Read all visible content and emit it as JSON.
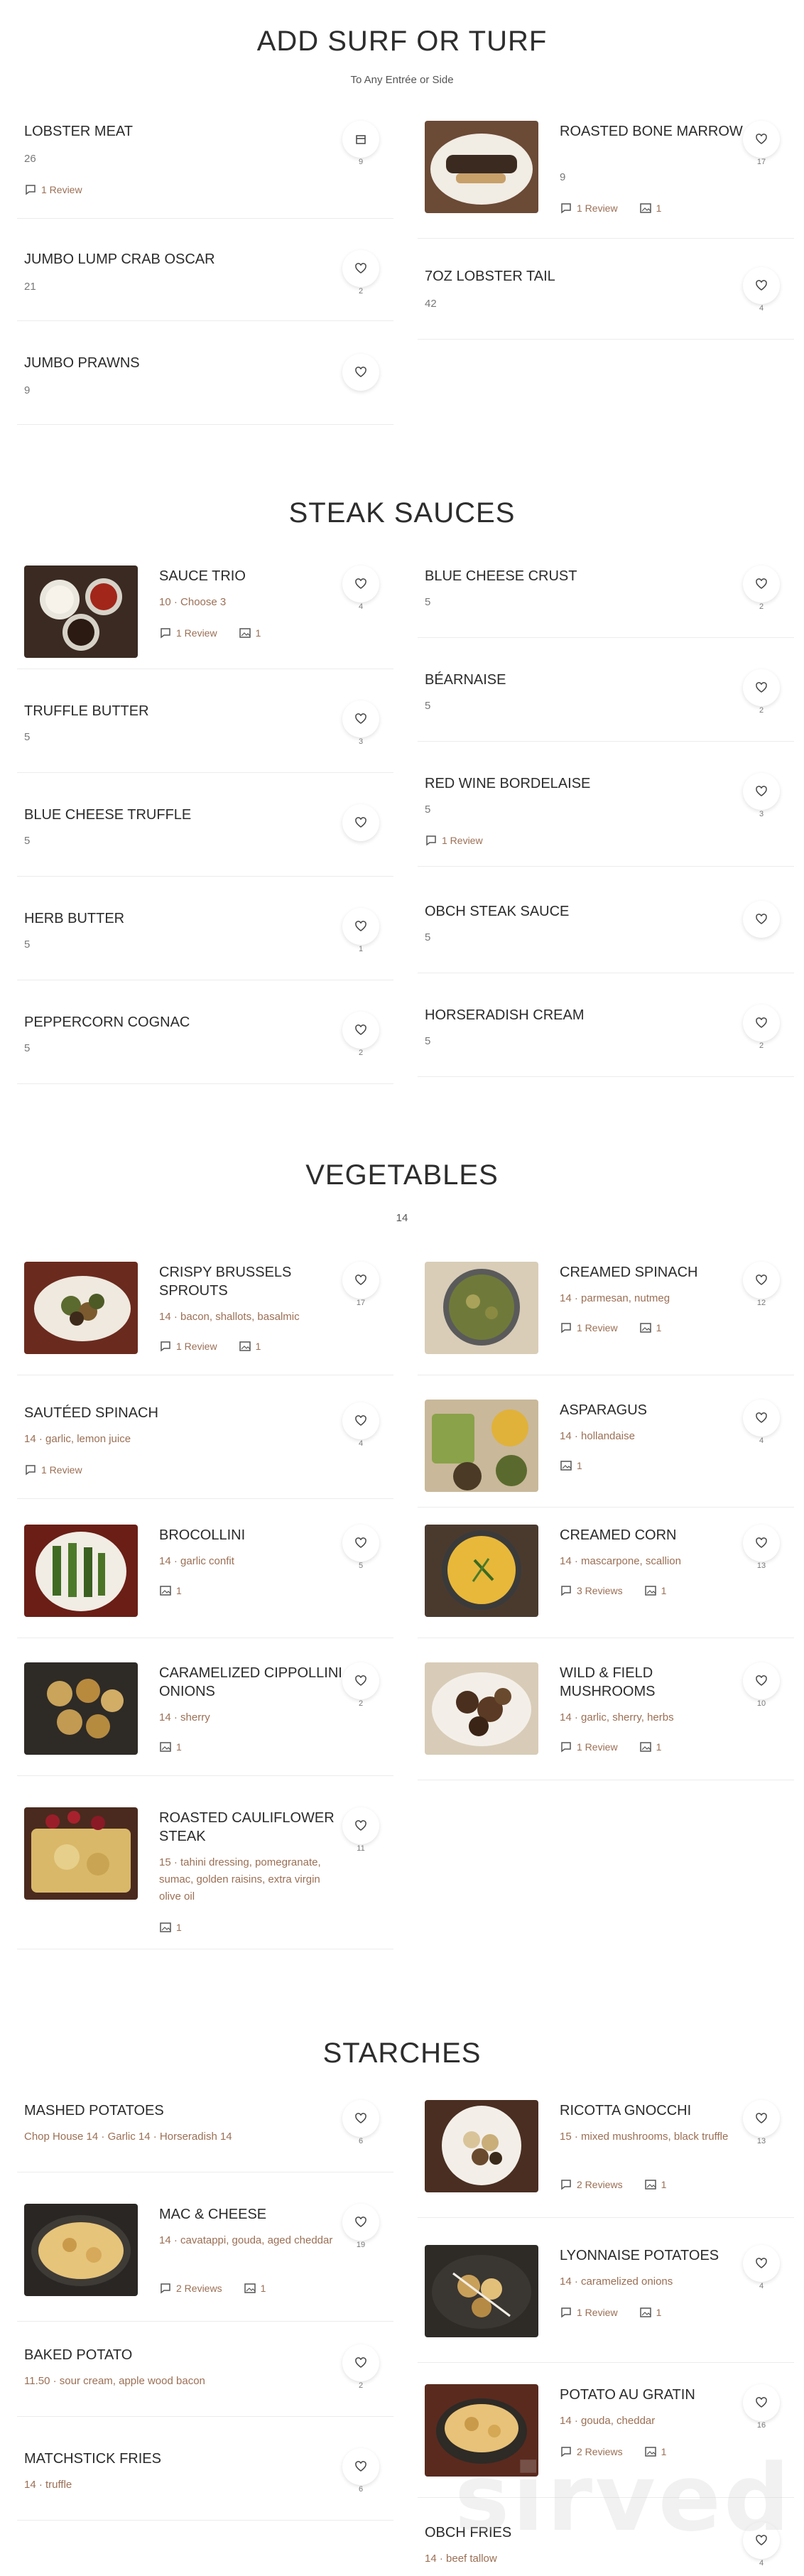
{
  "sections": {
    "surf": {
      "title": "ADD SURF OR TURF",
      "subtitle": "To Any Entrée or Side"
    },
    "sauces": {
      "title": "STEAK SAUCES"
    },
    "vegetables": {
      "title": "VEGETABLES",
      "subtitle": "14"
    },
    "starches": {
      "title": "STARCHES"
    }
  },
  "items": {
    "lobster_meat": {
      "name": "LOBSTER MEAT",
      "price": "26",
      "reviews": "1 Review",
      "count": "9"
    },
    "roasted_bone_marrow": {
      "name": "ROASTED BONE MARROW",
      "price": "9",
      "reviews": "1 Review",
      "photos": "1",
      "count": "17"
    },
    "jumbo_lump_crab": {
      "name": "JUMBO LUMP CRAB OSCAR",
      "price": "21",
      "count": "2"
    },
    "lobster_tail": {
      "name": "7OZ LOBSTER TAIL",
      "price": "42",
      "count": "4"
    },
    "jumbo_prawns": {
      "name": "JUMBO PRAWNS",
      "price": "9"
    },
    "sauce_trio": {
      "name": "SAUCE TRIO",
      "desc": "10 · Choose 3",
      "reviews": "1 Review",
      "photos": "1",
      "count": "4"
    },
    "blue_cheese_crust": {
      "name": "BLUE CHEESE CRUST",
      "price": "5",
      "count": "2"
    },
    "bearnaise": {
      "name": "BÉARNAISE",
      "price": "5",
      "count": "2"
    },
    "truffle_butter": {
      "name": "TRUFFLE BUTTER",
      "price": "5",
      "count": "3"
    },
    "red_wine_bordelaise": {
      "name": "RED WINE BORDELAISE",
      "price": "5",
      "reviews": "1 Review",
      "count": "3"
    },
    "blue_cheese_truffle": {
      "name": "BLUE CHEESE TRUFFLE",
      "price": "5"
    },
    "obch_steak_sauce": {
      "name": "OBCH STEAK SAUCE",
      "price": "5"
    },
    "herb_butter": {
      "name": "HERB BUTTER",
      "price": "5",
      "count": "1"
    },
    "horseradish_cream": {
      "name": "HORSERADISH CREAM",
      "price": "5",
      "count": "2"
    },
    "peppercorn_cognac": {
      "name": "PEPPERCORN COGNAC",
      "price": "5",
      "count": "2"
    },
    "crispy_brussels": {
      "name": "CRISPY BRUSSELS SPROUTS",
      "desc": "14 · bacon, shallots, basalmic",
      "reviews": "1 Review",
      "photos": "1",
      "count": "17"
    },
    "creamed_spinach": {
      "name": "CREAMED SPINACH",
      "desc": "14 · parmesan, nutmeg",
      "reviews": "1 Review",
      "photos": "1",
      "count": "12"
    },
    "sauteed_spinach": {
      "name": "SAUTÉED SPINACH",
      "desc": "14 · garlic, lemon juice",
      "reviews": "1 Review",
      "count": "4"
    },
    "asparagus": {
      "name": "ASPARAGUS",
      "desc": "14 · hollandaise",
      "photos": "1",
      "count": "4"
    },
    "brocollini": {
      "name": "BROCOLLINI",
      "desc": "14 · garlic confit",
      "photos": "1",
      "count": "5"
    },
    "creamed_corn": {
      "name": "CREAMED CORN",
      "desc": "14 · mascarpone, scallion",
      "reviews": "3 Reviews",
      "photos": "1",
      "count": "13"
    },
    "cippollini": {
      "name": "CARAMELIZED CIPPOLLINI ONIONS",
      "desc": "14 · sherry",
      "photos": "1",
      "count": "2"
    },
    "wild_mushrooms": {
      "name": "WILD & FIELD MUSHROOMS",
      "desc": "14 · garlic, sherry, herbs",
      "reviews": "1 Review",
      "photos": "1",
      "count": "10"
    },
    "roasted_cauliflower": {
      "name": "ROASTED CAULIFLOWER STEAK",
      "desc": "15 · tahini dressing, pomegranate, sumac, golden raisins, extra virgin olive oil",
      "photos": "1",
      "count": "11"
    },
    "mashed_potatoes": {
      "name": "MASHED POTATOES",
      "desc": "Chop House 14 · Garlic 14 · Horseradish 14",
      "count": "6"
    },
    "ricotta_gnocchi": {
      "name": "RICOTTA GNOCCHI",
      "desc": "15 · mixed mushrooms, black truffle",
      "reviews": "2 Reviews",
      "photos": "1",
      "count": "13"
    },
    "mac_cheese": {
      "name": "MAC & CHEESE",
      "desc": "14 · cavatappi, gouda, aged cheddar",
      "reviews": "2 Reviews",
      "photos": "1",
      "count": "19"
    },
    "lyonnaise": {
      "name": "LYONNAISE POTATOES",
      "desc": "14 · caramelized onions",
      "reviews": "1 Review",
      "photos": "1",
      "count": "4"
    },
    "baked_potato": {
      "name": "BAKED POTATO",
      "desc": "11.50 · sour cream, apple wood bacon",
      "count": "2"
    },
    "potato_au_gratin": {
      "name": "POTATO AU GRATIN",
      "desc": "14 · gouda, cheddar",
      "reviews": "2 Reviews",
      "photos": "1",
      "count": "16"
    },
    "matchstick_fries": {
      "name": "MATCHSTICK FRIES",
      "desc": "14 · truffle",
      "count": "6"
    },
    "obch_fries": {
      "name": "OBCH FRIES",
      "desc": "14 · beef tallow",
      "count": "4"
    }
  },
  "watermark": "sirved",
  "colors": {
    "accent": "#9b6f55",
    "title": "#2d2d2d"
  }
}
